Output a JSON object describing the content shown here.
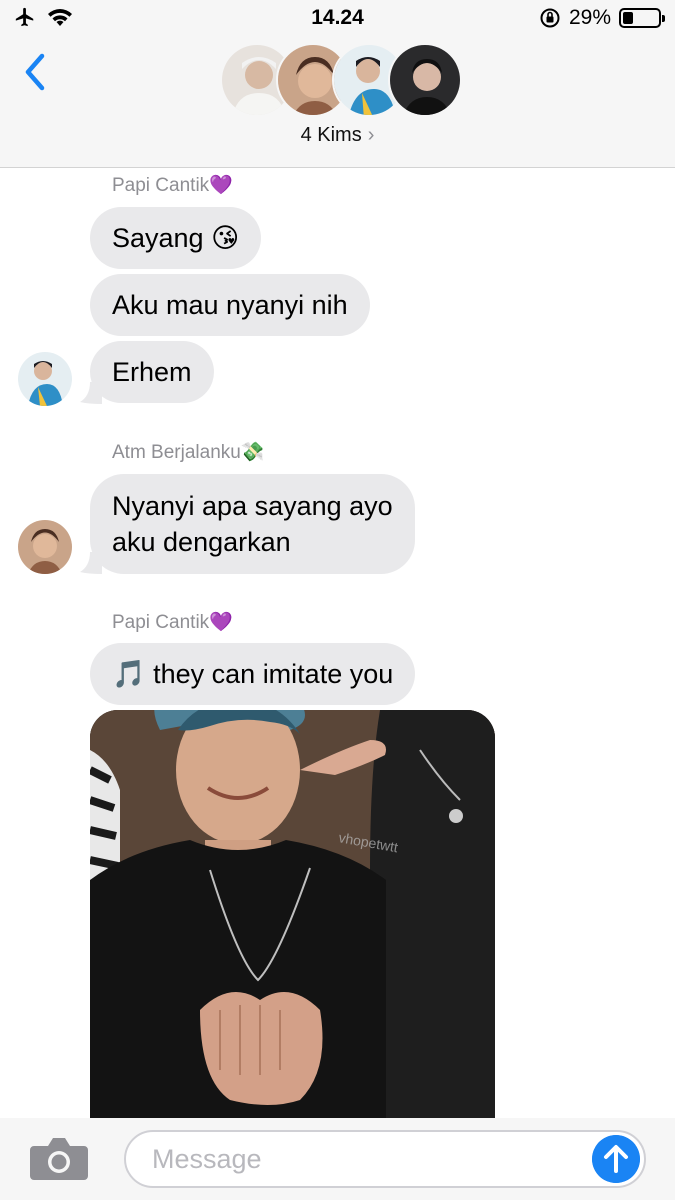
{
  "status_bar": {
    "time": "14.24",
    "battery_percent": "29%",
    "battery_level": 0.29,
    "icons": [
      "airplane-icon",
      "wifi-icon",
      "orientation-lock-icon",
      "battery-icon"
    ]
  },
  "header": {
    "back_icon": "chevron-left-icon",
    "group_name": "4 Kims",
    "chevron": "›",
    "avatar_count": 4
  },
  "messages": [
    {
      "sender": "Papi Cantik💜",
      "text": "Sayang 😘"
    },
    {
      "text": "Aku mau nyanyi nih"
    },
    {
      "text": "Erhem"
    },
    {
      "sender": "Atm Berjalanku💸",
      "text_line1": "Nyanyi apa sayang ayo",
      "text_line2": "aku dengarkan"
    },
    {
      "sender": "Papi Cantik💜",
      "text": "🎵 they can imitate you"
    }
  ],
  "photo": {
    "watermark": "vhopetwtt"
  },
  "input": {
    "placeholder": "Message",
    "camera_icon": "camera-icon",
    "send_icon": "arrow-up-icon"
  },
  "colors": {
    "bubble_gray": "#e9e9eb",
    "accent_blue": "#1a84f4",
    "secondary_text": "#8e8e93"
  }
}
